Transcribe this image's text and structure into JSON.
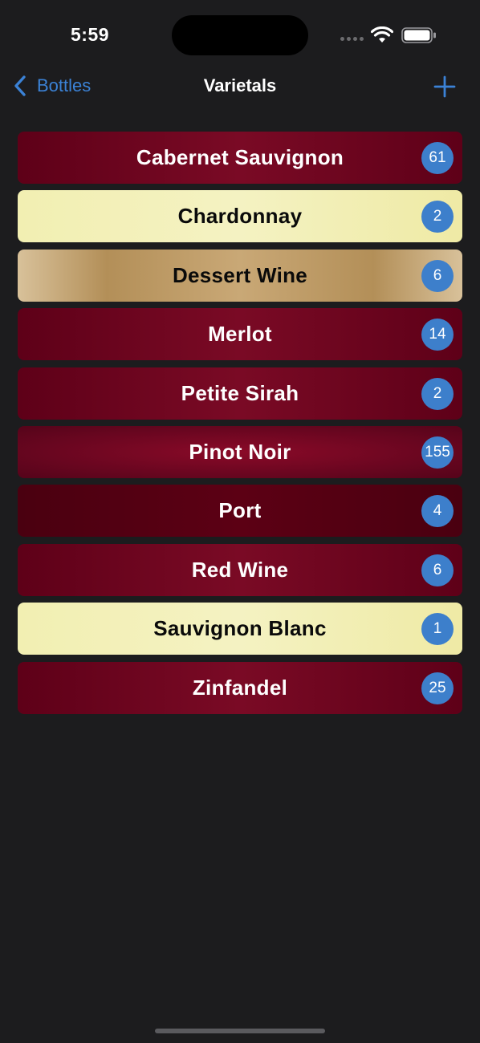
{
  "status_bar": {
    "time": "5:59"
  },
  "nav": {
    "back_label": "Bottles",
    "title": "Varietals",
    "add_icon": "plus-icon",
    "back_icon": "chevron-left-icon"
  },
  "colors": {
    "accent": "#3b82d6",
    "badge": "#3d7fcb",
    "background": "#1c1c1e",
    "red_wine": "#6a0620",
    "white_wine": "#f2efb2",
    "dessert_wine": "#b38f58"
  },
  "varietals": [
    {
      "name": "Cabernet Sauvignon",
      "count": "61",
      "style": "red"
    },
    {
      "name": "Chardonnay",
      "count": "2",
      "style": "cream"
    },
    {
      "name": "Dessert Wine",
      "count": "6",
      "style": "gold"
    },
    {
      "name": "Merlot",
      "count": "14",
      "style": "red"
    },
    {
      "name": "Petite Sirah",
      "count": "2",
      "style": "red"
    },
    {
      "name": "Pinot Noir",
      "count": "155",
      "style": "red-bright"
    },
    {
      "name": "Port",
      "count": "4",
      "style": "red-dark"
    },
    {
      "name": "Red Wine",
      "count": "6",
      "style": "red"
    },
    {
      "name": "Sauvignon Blanc",
      "count": "1",
      "style": "cream"
    },
    {
      "name": "Zinfandel",
      "count": "25",
      "style": "red"
    }
  ]
}
